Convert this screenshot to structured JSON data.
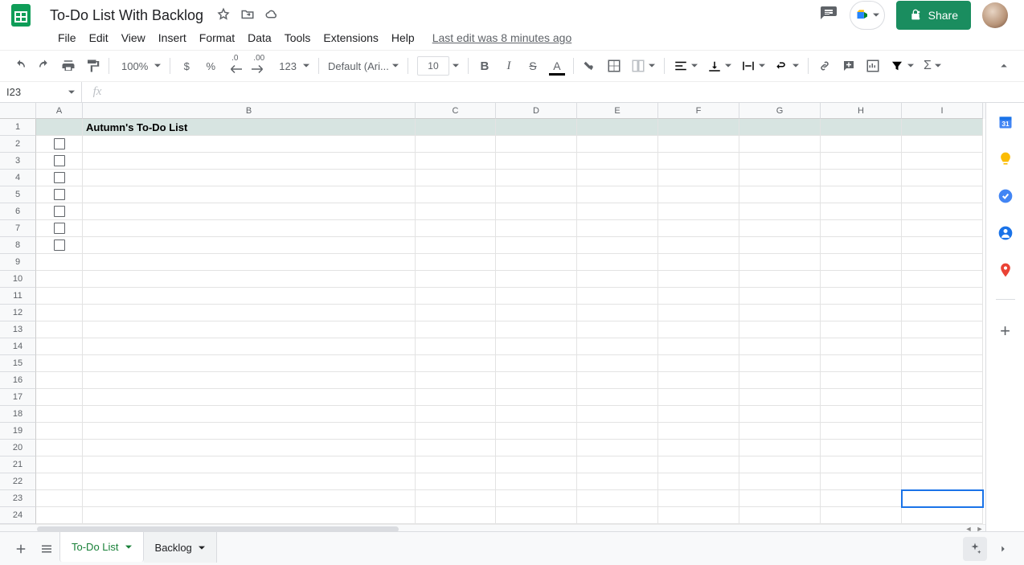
{
  "doc": {
    "title": "To-Do List With Backlog"
  },
  "menu": {
    "file": "File",
    "edit": "Edit",
    "view": "View",
    "insert": "Insert",
    "format": "Format",
    "data": "Data",
    "tools": "Tools",
    "extensions": "Extensions",
    "help": "Help",
    "last_edit": "Last edit was 8 minutes ago"
  },
  "toolbar": {
    "zoom": "100%",
    "currency": "$",
    "percent": "%",
    "dec_dec": ".0",
    "inc_dec": ".00",
    "num_fmt": "123",
    "font": "Default (Ari...",
    "font_size": "10"
  },
  "namebox": {
    "ref": "I23"
  },
  "fx": {
    "placeholder": ""
  },
  "share": {
    "label": "Share"
  },
  "columns": [
    "A",
    "B",
    "C",
    "D",
    "E",
    "F",
    "G",
    "H",
    "I"
  ],
  "col_widths": {
    "A": 58,
    "B": 414,
    "C": 100,
    "D": 101,
    "E": 101,
    "F": 101,
    "G": 101,
    "H": 101,
    "I": 101
  },
  "rows": [
    1,
    2,
    3,
    4,
    5,
    6,
    7,
    8,
    9,
    10,
    11,
    12,
    13,
    14,
    15,
    16,
    17,
    18,
    19,
    20,
    21,
    22,
    23,
    24
  ],
  "checkbox_rows": [
    2,
    3,
    4,
    5,
    6,
    7,
    8
  ],
  "selected_cell": "I23",
  "cells": {
    "B1": "Autumn's To-Do List"
  },
  "tabs": [
    {
      "name": "To-Do List",
      "active": true
    },
    {
      "name": "Backlog",
      "active": false
    }
  ]
}
